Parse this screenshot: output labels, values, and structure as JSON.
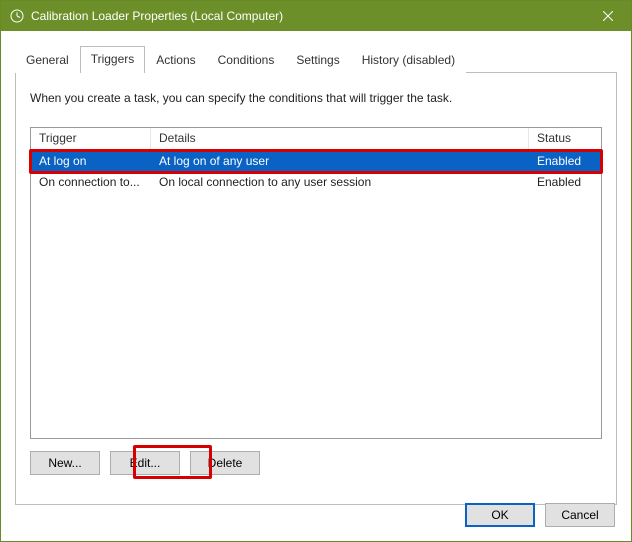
{
  "window": {
    "title": "Calibration Loader Properties (Local Computer)"
  },
  "tabs": {
    "general": "General",
    "triggers": "Triggers",
    "actions": "Actions",
    "conditions": "Conditions",
    "settings": "Settings",
    "history": "History (disabled)"
  },
  "active_tab": "triggers",
  "description": "When you create a task, you can specify the conditions that will trigger the task.",
  "columns": {
    "trigger": "Trigger",
    "details": "Details",
    "status": "Status"
  },
  "rows": [
    {
      "trigger": "At log on",
      "details": "At log on of any user",
      "status": "Enabled",
      "selected": true
    },
    {
      "trigger": "On connection to...",
      "details": "On local connection to any user session",
      "status": "Enabled",
      "selected": false
    }
  ],
  "buttons": {
    "new": "New...",
    "edit": "Edit...",
    "delete": "Delete",
    "ok": "OK",
    "cancel": "Cancel"
  }
}
